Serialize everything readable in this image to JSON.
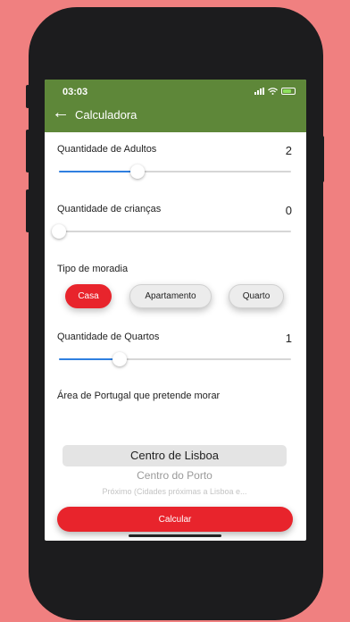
{
  "status_bar": {
    "time": "03:03"
  },
  "header": {
    "title": "Calculadora"
  },
  "adults": {
    "label": "Quantidade de Adultos",
    "value": "2",
    "slider_fraction": 0.34
  },
  "children": {
    "label": "Quantidade de crianças",
    "value": "0",
    "slider_fraction": 0.0
  },
  "housing": {
    "label": "Tipo de moradia",
    "options": [
      "Casa",
      "Apartamento",
      "Quarto"
    ],
    "selected": "Casa"
  },
  "rooms": {
    "label": "Quantidade de Quartos",
    "value": "1",
    "slider_fraction": 0.26
  },
  "area": {
    "label": "Área de Portugal que pretende morar",
    "options": [
      "Centro de Lisboa",
      "Centro do Porto",
      "Próximo (Cidades próximas a Lisboa e..."
    ],
    "selected": "Centro de Lisboa"
  },
  "calculate_label": "Calcular",
  "colors": {
    "header": "#5E8739",
    "accent": "#E8242C",
    "slider": "#2F7FE0",
    "background": "#F08080"
  }
}
